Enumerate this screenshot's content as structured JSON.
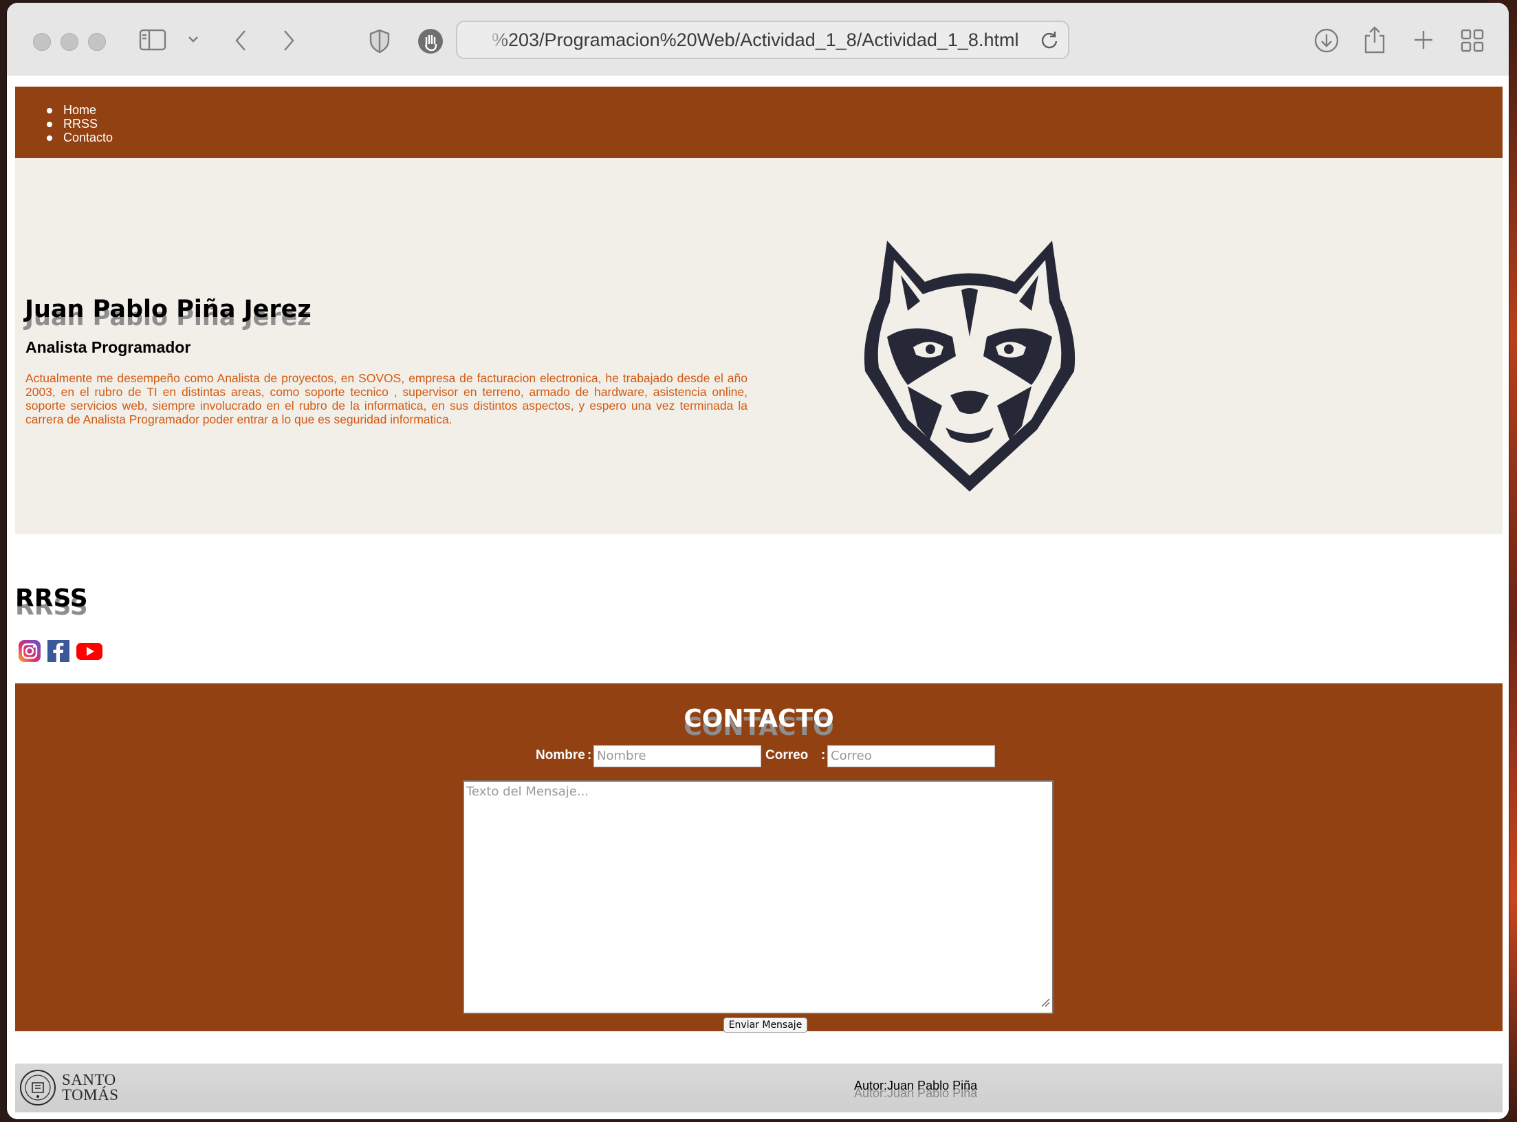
{
  "browser": {
    "url": "%203/Programacion%20Web/Actividad_1_8/Actividad_1_8.html"
  },
  "nav": {
    "items": [
      "Home",
      "RRSS",
      "Contacto"
    ]
  },
  "hero": {
    "name": "Juan Pablo Piña Jerez",
    "role": "Analista Programador",
    "bio": "Actualmente me desempeño como Analista de proyectos, en SOVOS, empresa de facturacion electronica, he trabajado desde el año 2003, en el rubro de TI en distintas areas, como soporte tecnico , supervisor en terreno, armado de hardware, asistencia online, soporte servicios web, siempre involucrado en el rubro de la informatica, en sus distintos aspectos, y espero una vez terminada la carrera de Analista Programador poder entrar a lo que es seguridad informatica.",
    "image": "wolf-logo-icon"
  },
  "rrss": {
    "title": "RRSS",
    "icons": [
      "instagram-icon",
      "facebook-icon",
      "youtube-icon"
    ]
  },
  "contact": {
    "title": "CONTACTO",
    "name_label": "Nombre",
    "name_sep": ":",
    "name_placeholder": "Nombre",
    "email_label": "Correo",
    "email_sep": ":",
    "email_placeholder": "Correo",
    "message_placeholder": "Texto del Mensaje...",
    "send_label": "Enviar Mensaje"
  },
  "footer": {
    "logo_line1": "SANTO",
    "logo_line2": "TOMÁS",
    "author": "Autor:Juan Pablo Piña"
  },
  "colors": {
    "nav_bg": "#924113",
    "hero_bg": "#f2efe9",
    "bio_text": "#d35a12"
  }
}
